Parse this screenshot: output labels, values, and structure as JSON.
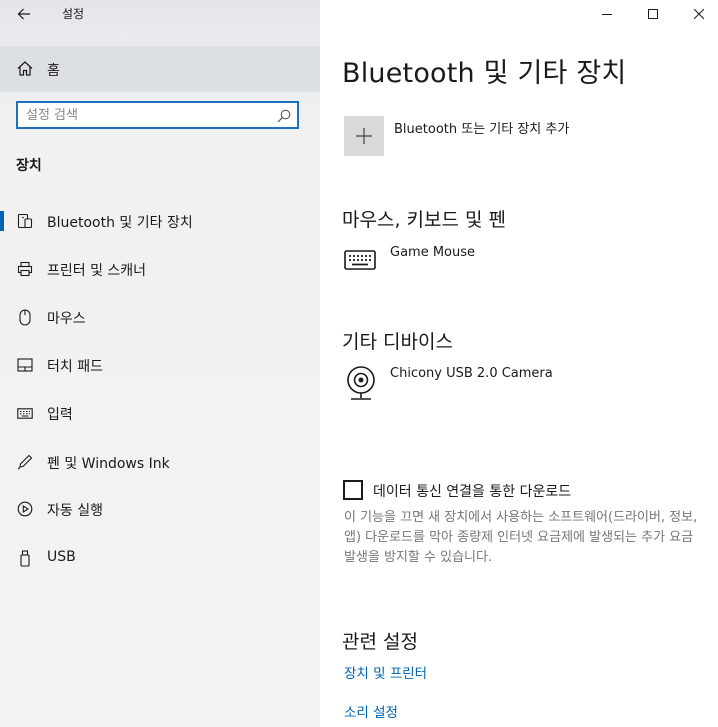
{
  "window": {
    "title": "설정",
    "back_icon": "arrow-left-icon",
    "controls": [
      "minimize-icon",
      "maximize-icon",
      "close-icon"
    ]
  },
  "sidebar": {
    "home": {
      "label": "홈",
      "icon": "home-icon"
    },
    "search": {
      "placeholder": "설정 검색",
      "value": "",
      "icon": "search-icon"
    },
    "section_label": "장치",
    "items": [
      {
        "label": "Bluetooth 및 기타 장치",
        "icon": "bluetooth-devices-icon",
        "selected": true
      },
      {
        "label": "프린터 및 스캐너",
        "icon": "printer-icon",
        "selected": false
      },
      {
        "label": "마우스",
        "icon": "mouse-icon",
        "selected": false
      },
      {
        "label": "터치 패드",
        "icon": "touchpad-icon",
        "selected": false
      },
      {
        "label": "입력",
        "icon": "keyboard-icon",
        "selected": false
      },
      {
        "label": "펜 및 Windows Ink",
        "icon": "pen-icon",
        "selected": false
      },
      {
        "label": "자동 실행",
        "icon": "autoplay-icon",
        "selected": false
      },
      {
        "label": "USB",
        "icon": "usb-icon",
        "selected": false
      }
    ],
    "selected_accent": "#0063b1"
  },
  "main": {
    "title": "Bluetooth 및 기타 장치",
    "add_device": {
      "label": "Bluetooth 또는 기타 장치 추가",
      "icon": "plus-icon"
    },
    "mouse_keyboard_pen": {
      "heading": "마우스, 키보드 및 펜",
      "devices": [
        {
          "name": "Game Mouse",
          "icon": "keyboard-icon"
        }
      ]
    },
    "other_devices": {
      "heading": "기타 디바이스",
      "devices": [
        {
          "name": "Chicony USB 2.0 Camera",
          "icon": "webcam-icon"
        }
      ]
    },
    "metered_download": {
      "checkbox_label": "데이터 통신 연결을 통한 다운로드",
      "checked": false,
      "description": "이 기능을 끄면 새 장치에서 사용하는 소프트웨어(드라이버, 정보, 앱) 다운로드를 막아 종량제 인터넷 요금제에 발생되는 추가 요금 발생을 방지할 수 있습니다."
    },
    "related_settings": {
      "heading": "관련 설정",
      "links": [
        "장치 및 프린터",
        "소리 설정"
      ]
    },
    "link_color": "#0063b1"
  }
}
